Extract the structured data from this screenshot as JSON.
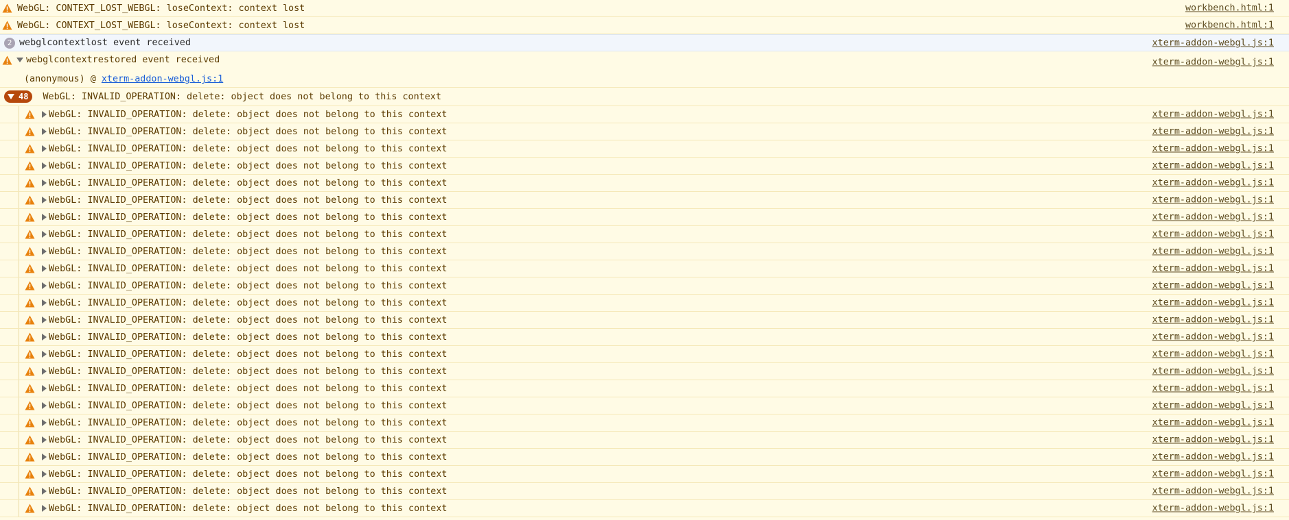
{
  "console": {
    "colors": {
      "warning_bg": "#fffbe5",
      "warning_text": "#5c3b00",
      "warning_icon": "#e8820e",
      "group_badge": "#b6480c",
      "info_bg": "#f2f6fc"
    },
    "top_warnings": [
      {
        "message": "WebGL: CONTEXT_LOST_WEBGL: loseContext: context lost",
        "source": "workbench.html:1",
        "icon": "warning-icon"
      },
      {
        "message": "WebGL: CONTEXT_LOST_WEBGL: loseContext: context lost",
        "source": "workbench.html:1",
        "icon": "warning-icon"
      }
    ],
    "info_row": {
      "count": "2",
      "message": "webglcontextlost event received",
      "source": "xterm-addon-webgl.js:1"
    },
    "restored_row": {
      "message": "webglcontextrestored event received",
      "source": "xterm-addon-webgl.js:1",
      "stack_prefix": "(anonymous) @ ",
      "stack_link": "xterm-addon-webgl.js:1"
    },
    "group": {
      "count": "48",
      "message": "WebGL: INVALID_OPERATION: delete: object does not belong to this context"
    },
    "group_children": [
      {
        "message": "WebGL: INVALID_OPERATION: delete: object does not belong to this context",
        "source": "xterm-addon-webgl.js:1"
      },
      {
        "message": "WebGL: INVALID_OPERATION: delete: object does not belong to this context",
        "source": "xterm-addon-webgl.js:1"
      },
      {
        "message": "WebGL: INVALID_OPERATION: delete: object does not belong to this context",
        "source": "xterm-addon-webgl.js:1"
      },
      {
        "message": "WebGL: INVALID_OPERATION: delete: object does not belong to this context",
        "source": "xterm-addon-webgl.js:1"
      },
      {
        "message": "WebGL: INVALID_OPERATION: delete: object does not belong to this context",
        "source": "xterm-addon-webgl.js:1"
      },
      {
        "message": "WebGL: INVALID_OPERATION: delete: object does not belong to this context",
        "source": "xterm-addon-webgl.js:1"
      },
      {
        "message": "WebGL: INVALID_OPERATION: delete: object does not belong to this context",
        "source": "xterm-addon-webgl.js:1"
      },
      {
        "message": "WebGL: INVALID_OPERATION: delete: object does not belong to this context",
        "source": "xterm-addon-webgl.js:1"
      },
      {
        "message": "WebGL: INVALID_OPERATION: delete: object does not belong to this context",
        "source": "xterm-addon-webgl.js:1"
      },
      {
        "message": "WebGL: INVALID_OPERATION: delete: object does not belong to this context",
        "source": "xterm-addon-webgl.js:1"
      },
      {
        "message": "WebGL: INVALID_OPERATION: delete: object does not belong to this context",
        "source": "xterm-addon-webgl.js:1"
      },
      {
        "message": "WebGL: INVALID_OPERATION: delete: object does not belong to this context",
        "source": "xterm-addon-webgl.js:1"
      },
      {
        "message": "WebGL: INVALID_OPERATION: delete: object does not belong to this context",
        "source": "xterm-addon-webgl.js:1"
      },
      {
        "message": "WebGL: INVALID_OPERATION: delete: object does not belong to this context",
        "source": "xterm-addon-webgl.js:1"
      },
      {
        "message": "WebGL: INVALID_OPERATION: delete: object does not belong to this context",
        "source": "xterm-addon-webgl.js:1"
      },
      {
        "message": "WebGL: INVALID_OPERATION: delete: object does not belong to this context",
        "source": "xterm-addon-webgl.js:1"
      },
      {
        "message": "WebGL: INVALID_OPERATION: delete: object does not belong to this context",
        "source": "xterm-addon-webgl.js:1"
      },
      {
        "message": "WebGL: INVALID_OPERATION: delete: object does not belong to this context",
        "source": "xterm-addon-webgl.js:1"
      },
      {
        "message": "WebGL: INVALID_OPERATION: delete: object does not belong to this context",
        "source": "xterm-addon-webgl.js:1"
      },
      {
        "message": "WebGL: INVALID_OPERATION: delete: object does not belong to this context",
        "source": "xterm-addon-webgl.js:1"
      },
      {
        "message": "WebGL: INVALID_OPERATION: delete: object does not belong to this context",
        "source": "xterm-addon-webgl.js:1"
      },
      {
        "message": "WebGL: INVALID_OPERATION: delete: object does not belong to this context",
        "source": "xterm-addon-webgl.js:1"
      },
      {
        "message": "WebGL: INVALID_OPERATION: delete: object does not belong to this context",
        "source": "xterm-addon-webgl.js:1"
      },
      {
        "message": "WebGL: INVALID_OPERATION: delete: object does not belong to this context",
        "source": "xterm-addon-webgl.js:1"
      }
    ]
  }
}
